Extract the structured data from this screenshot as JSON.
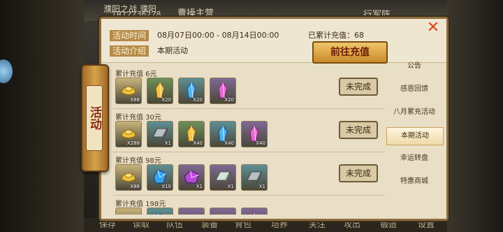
{
  "top": {
    "left_text": "濮阳之战  濮阳",
    "uid": "TR12736278",
    "title": "曹操主营",
    "right_text": "行军阵"
  },
  "bottom_bar": [
    "保存",
    "读取",
    "队伍",
    "装备",
    "背包",
    "培养",
    "关注",
    "攻出",
    "锻造",
    "设置"
  ],
  "side_tab_label": "活动",
  "event": {
    "time_label": "活动时间",
    "time_value": "08月07日00:00 - 08月14日00:00",
    "intro_label": "活动介绍",
    "intro_value": "本期活动",
    "total_recharge": "已累计充值：68",
    "recharge_button": "前往充值"
  },
  "tiers": [
    {
      "title": "累计充值 6元",
      "status": "未完成",
      "items": [
        {
          "icon": "gold-ingot",
          "count": "X88",
          "bg": "#c8b37a"
        },
        {
          "icon": "gold-crystal",
          "count": "X20",
          "bg": "#6d8f5a"
        },
        {
          "icon": "blue-crystal",
          "count": "X20",
          "bg": "#5f8f94"
        },
        {
          "icon": "pink-crystal",
          "count": "X20",
          "bg": "#7f6a94"
        }
      ]
    },
    {
      "title": "累计充值 30元",
      "status": "未完成",
      "items": [
        {
          "icon": "gold-ingot",
          "count": "X288",
          "bg": "#c8b37a"
        },
        {
          "icon": "iron-ingot",
          "count": "X1",
          "bg": "#5f8f94"
        },
        {
          "icon": "gold-crystal",
          "count": "X40",
          "bg": "#6d8f5a"
        },
        {
          "icon": "blue-crystal",
          "count": "X40",
          "bg": "#5f8f94"
        },
        {
          "icon": "pink-crystal",
          "count": "X40",
          "bg": "#7f6a94"
        }
      ]
    },
    {
      "title": "累计充值 98元",
      "status": "未完成",
      "items": [
        {
          "icon": "gold-ingot",
          "count": "X88",
          "bg": "#c8b37a"
        },
        {
          "icon": "blue-gem",
          "count": "X10",
          "bg": "#5f8f94"
        },
        {
          "icon": "purple-gem",
          "count": "X1",
          "bg": "#7f6a94"
        },
        {
          "icon": "jade-ingot",
          "count": "X1",
          "bg": "#7f6a94"
        },
        {
          "icon": "iron-ingot",
          "count": "X1",
          "bg": "#5f8f94"
        }
      ]
    },
    {
      "title": "累计充值 198元",
      "status": "",
      "items": [
        {
          "icon": "gold-ingot",
          "count": "",
          "bg": "#c8b37a"
        },
        {
          "icon": "blue-gem",
          "count": "",
          "bg": "#5f8f94"
        },
        {
          "icon": "purple-gem",
          "count": "",
          "bg": "#7f6a94"
        },
        {
          "icon": "jade-ingot",
          "count": "",
          "bg": "#7f6a94"
        },
        {
          "icon": "pink-crystal",
          "count": "",
          "bg": "#7f6a94"
        }
      ]
    }
  ],
  "nav": [
    {
      "label": "公告",
      "active": false
    },
    {
      "label": "感恩回馈",
      "active": false
    },
    {
      "label": "八月累充活动",
      "active": false
    },
    {
      "label": "本期活动",
      "active": true
    },
    {
      "label": "幸运转盘",
      "active": false
    },
    {
      "label": "特惠商城",
      "active": false
    }
  ],
  "close_icon": "close-x-icon"
}
